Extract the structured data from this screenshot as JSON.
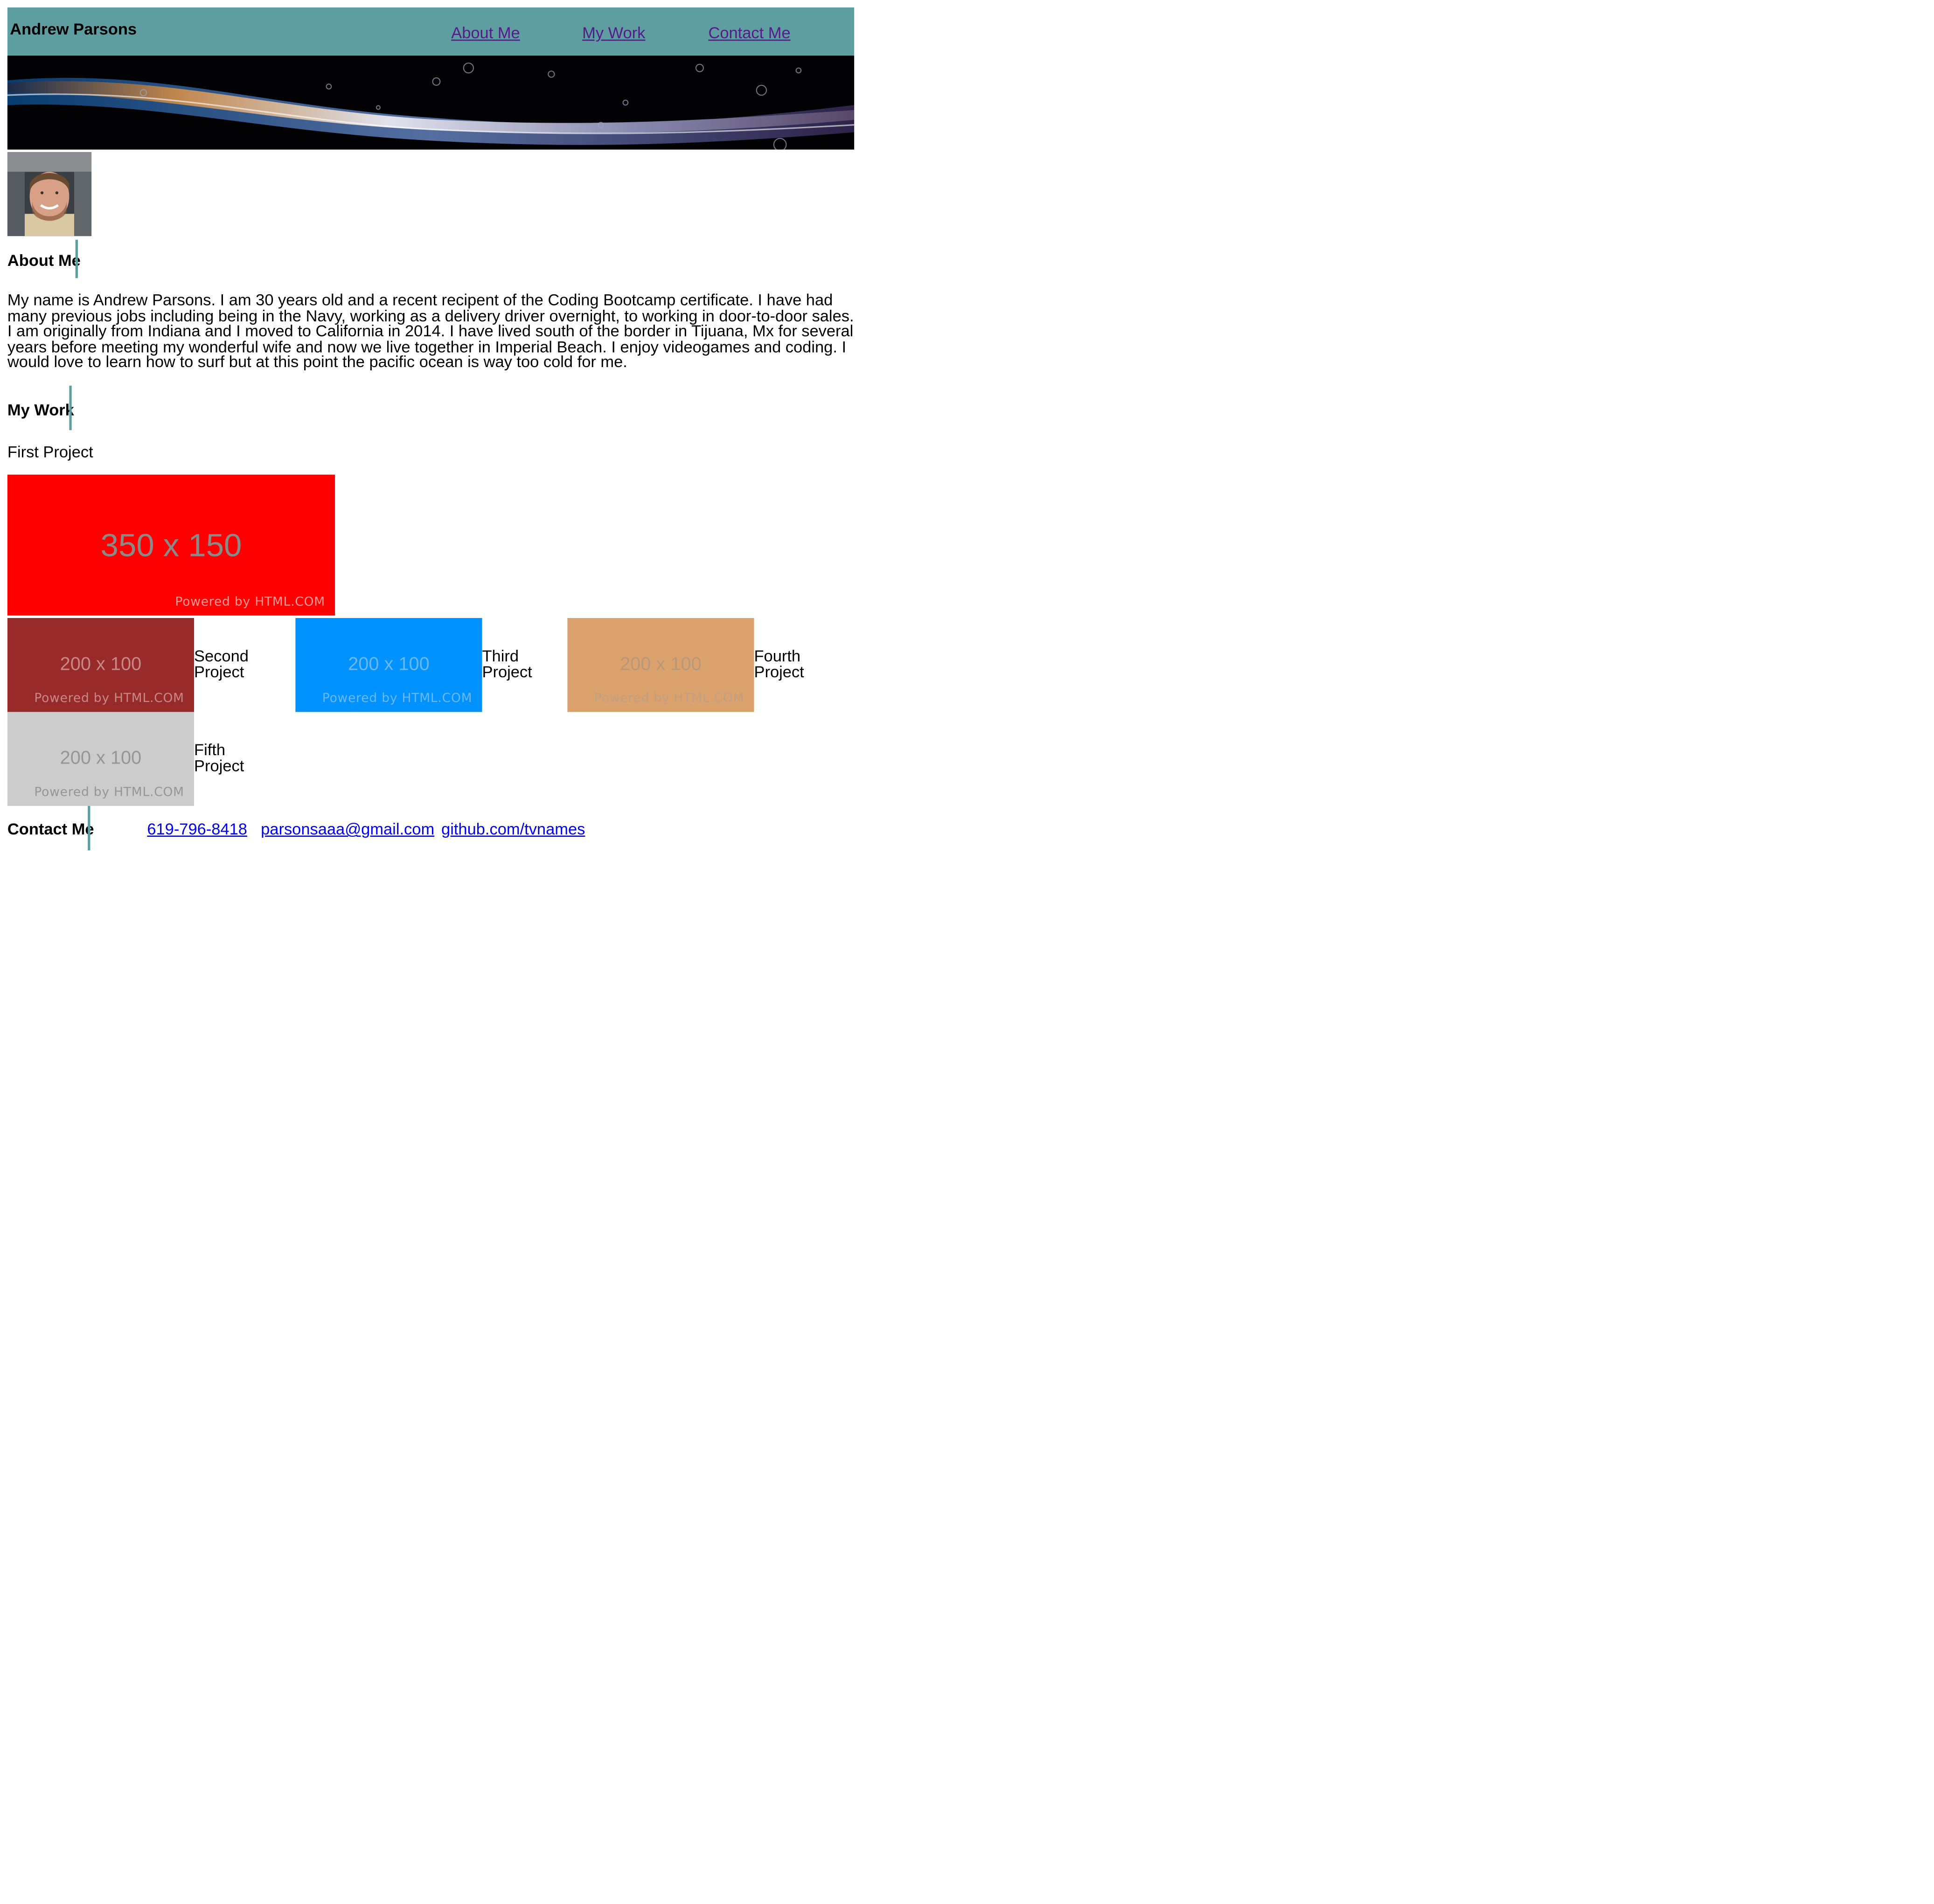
{
  "header": {
    "title": "Andrew Parsons",
    "nav": [
      "About Me",
      "My Work",
      "Contact Me"
    ]
  },
  "about": {
    "heading": "About Me",
    "text": "My name is Andrew Parsons. I am 30 years old and a recent recipent of the Coding Bootcamp certificate. I have had many previous jobs including being in the Navy, working as a delivery driver overnight, to working in door-to-door sales. I am originally from Indiana and I moved to California in 2014. I have lived south of the border in Tijuana, Mx for several years before meeting my wonderful wife and now we live together in Imperial Beach. I enjoy videogames and coding. I would love to learn how to surf but at this point the pacific ocean is way too cold for me."
  },
  "work": {
    "heading": "My Work",
    "first": {
      "label": "First Project",
      "size": "350 x 150",
      "powered": "Powered by HTML.COM",
      "color": "#ff0000"
    },
    "projects": [
      {
        "label_1": "Second",
        "label_2": "Project",
        "size": "200 x 100",
        "powered": "Powered by HTML.COM",
        "color": "#992a2a"
      },
      {
        "label_1": "Third",
        "label_2": "Project",
        "size": "200 x 100",
        "powered": "Powered by HTML.COM",
        "color": "#0093ff"
      },
      {
        "label_1": "Fourth",
        "label_2": "Project",
        "size": "200 x 100",
        "powered": "Powered by HTML.COM",
        "color": "#dba26e"
      },
      {
        "label_1": "Fifth",
        "label_2": "Project",
        "size": "200 x 100",
        "powered": "Powered by HTML.COM",
        "color": "#cccccc"
      }
    ]
  },
  "contact": {
    "heading": "Contact Me",
    "phone": "619-796-8418",
    "email": "parsonsaaa@gmail.com",
    "github": "github.com/tvnames"
  },
  "colors": {
    "accent": "#5f9ea0",
    "link": "#0000ee",
    "visited": "#551a8b"
  },
  "icons": {
    "banner": "abstract-swirl-image",
    "profile": "profile-photo"
  }
}
